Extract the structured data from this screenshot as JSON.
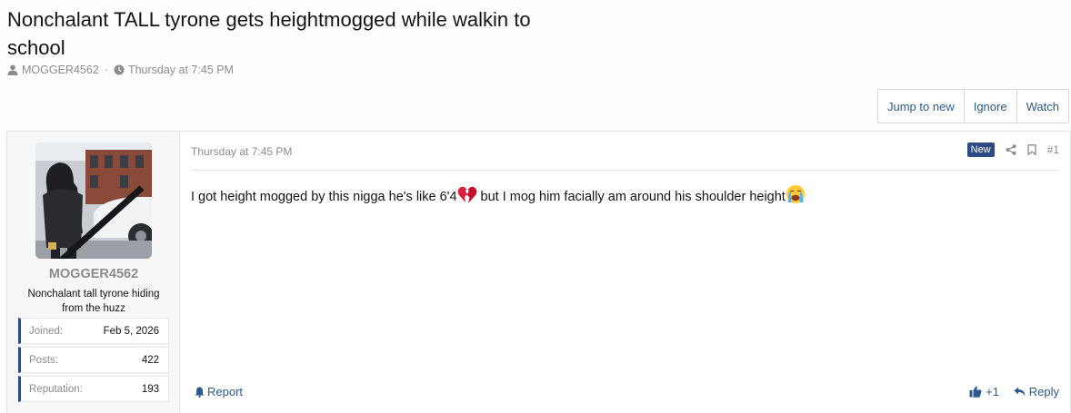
{
  "thread": {
    "title": "Nonchalant TALL tyrone gets heightmogged while walkin to school",
    "author": "MOGGER4562",
    "separator": "·",
    "date": "Thursday at 7:45 PM"
  },
  "actions": {
    "jump_to_new": "Jump to new",
    "ignore": "Ignore",
    "watch": "Watch"
  },
  "user": {
    "name": "MOGGER4562",
    "title": "Nonchalant tall tyrone hiding from the huzz",
    "stats": [
      {
        "label": "Joined:",
        "value": "Feb 5, 2026"
      },
      {
        "label": "Posts:",
        "value": "422"
      },
      {
        "label": "Reputation:",
        "value": "193"
      }
    ]
  },
  "post": {
    "date": "Thursday at 7:45 PM",
    "new_badge": "New",
    "number": "#1",
    "body_part1": "I got height mogged by this nigga he's like 6'4",
    "body_part2": " but I mog him facially am around his shoulder height",
    "emoji_1": "broken-heart",
    "emoji_2": "loudly-crying-face",
    "report_label": "Report",
    "reaction_count": "+1",
    "reply_label": "Reply"
  },
  "colors": {
    "accent": "#2c4a83",
    "link": "#2b5a8c",
    "muted": "#8c8c8c"
  }
}
